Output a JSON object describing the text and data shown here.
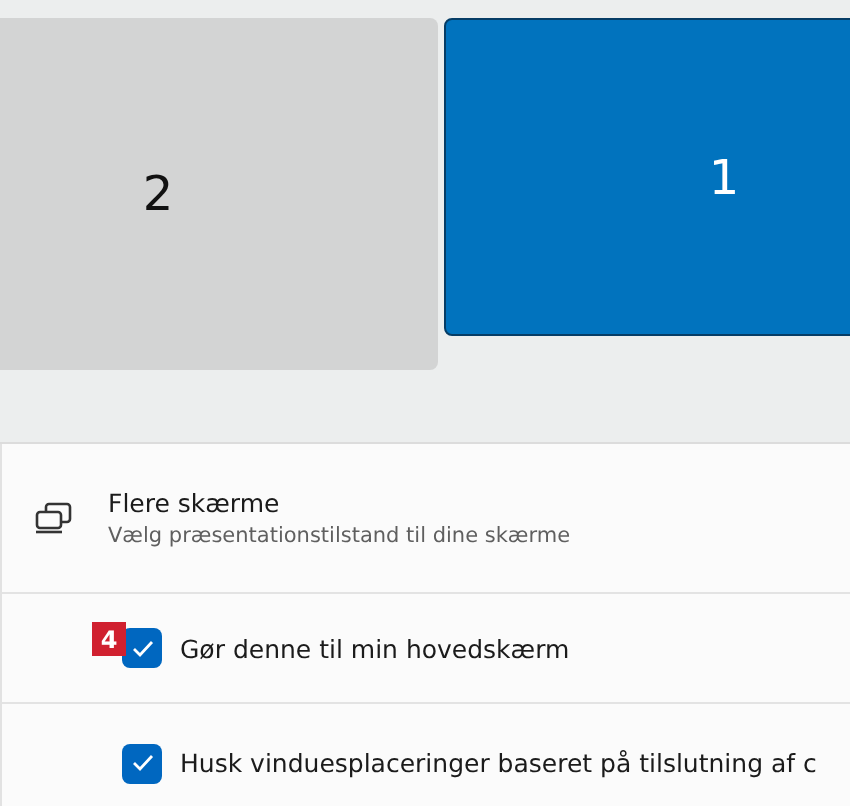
{
  "displays": [
    {
      "label": "2",
      "selected": false
    },
    {
      "label": "1",
      "selected": true
    }
  ],
  "section": {
    "title": "Flere skærme",
    "subtitle": "Vælg præsentationstilstand til dine skærme"
  },
  "options": [
    {
      "label": "Gør denne til min hovedskærm",
      "checked": true,
      "badge": "4"
    },
    {
      "label": "Husk vinduesplaceringer baseret på tilslutning af c",
      "checked": true
    }
  ]
}
